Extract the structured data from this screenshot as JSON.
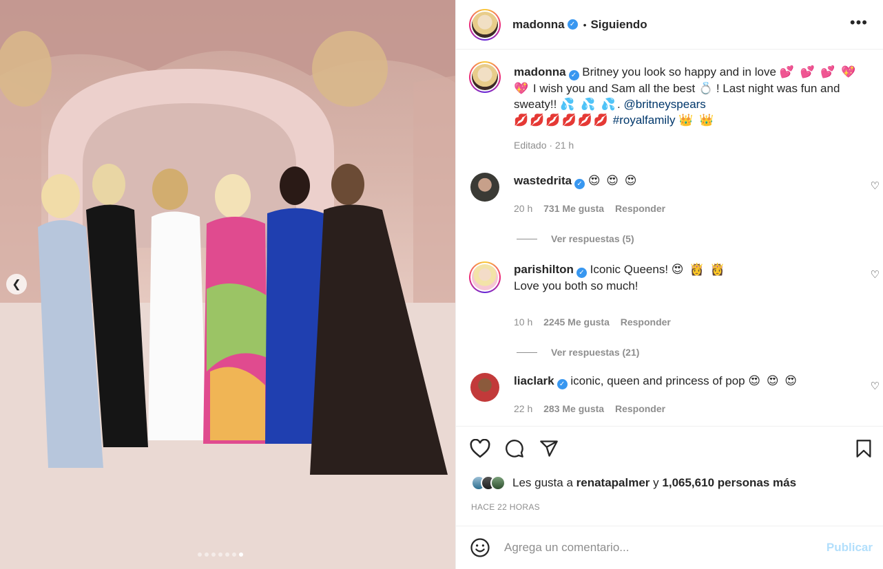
{
  "post": {
    "author": "madonna",
    "follow_status": "Siguiendo",
    "more_label": "•••",
    "carousel": {
      "total_slides": 7,
      "active_index": 6
    }
  },
  "caption": {
    "username": "madonna",
    "line1": "Britney you look so happy and in love",
    "line1_emoji": "💕 💕 💕 💖",
    "line2_emoji": "💖",
    "line2": "I wish you and Sam all the best",
    "ring_emoji": "💍",
    "line2_tail": "! Last night was fun and",
    "line3": "sweaty!!",
    "sweat_emoji": "💦 💦 💦",
    "mention": "@britneyspears",
    "lips_emoji": "💋💋💋💋💋💋",
    "hashtag": "#royalfamily",
    "crown_emoji": "👑 👑",
    "meta": "Editado · 21 h"
  },
  "comments": [
    {
      "username": "wastedrita",
      "text": "",
      "emoji": "😍 😍 😍",
      "time": "20 h",
      "likes": "731 Me gusta",
      "reply": "Responder",
      "view_replies": "Ver respuestas (5)"
    },
    {
      "username": "parishilton",
      "text": "Iconic Queens!",
      "emoji": "😍 👸 👸",
      "text2": "Love you both so much!",
      "time": "10 h",
      "likes": "2245 Me gusta",
      "reply": "Responder",
      "view_replies": "Ver respuestas (21)"
    },
    {
      "username": "liaclark",
      "text": "iconic, queen and princess of pop",
      "emoji": "😍 😍 😍",
      "time": "22 h",
      "likes": "283 Me gusta",
      "reply": "Responder"
    }
  ],
  "likes": {
    "prefix": "Les gusta a",
    "user": "renatapalmer",
    "connector": "y",
    "others": "1,065,610 personas más"
  },
  "time_ago": "HACE 22 HORAS",
  "add_comment": {
    "placeholder": "Agrega un comentario...",
    "publish_label": "Publicar"
  },
  "colors": {
    "link": "#00376b",
    "verified": "#3897f0",
    "publish_disabled": "#b2dffc",
    "muted": "#8e8e8e"
  }
}
